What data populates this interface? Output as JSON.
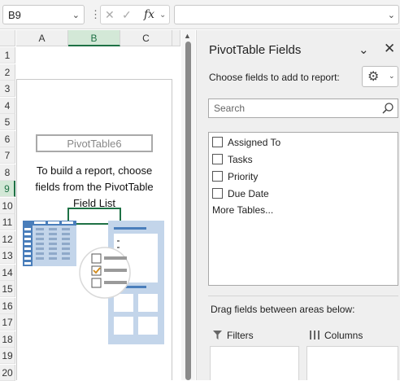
{
  "formula_bar": {
    "name_box": "B9",
    "more_dots": "⋮",
    "cancel_glyph": "✕",
    "enter_glyph": "✓",
    "fx_label": "fx",
    "formula_value": ""
  },
  "grid": {
    "columns": [
      "A",
      "B",
      "C"
    ],
    "selected_column": "B",
    "rows": [
      "1",
      "2",
      "3",
      "4",
      "5",
      "6",
      "7",
      "8",
      "9",
      "10",
      "11",
      "12",
      "13",
      "14",
      "15",
      "16",
      "17",
      "18",
      "19",
      "20"
    ],
    "selected_row": "9"
  },
  "pivot_placeholder": {
    "name": "PivotTable6",
    "instructions": "To build a report, choose fields from the PivotTable Field List"
  },
  "panel": {
    "title": "PivotTable Fields",
    "choose_label": "Choose fields to add to report:",
    "search_placeholder": "Search",
    "fields": [
      {
        "label": "Assigned To",
        "checked": false
      },
      {
        "label": "Tasks",
        "checked": false
      },
      {
        "label": "Priority",
        "checked": false
      },
      {
        "label": "Due Date",
        "checked": false
      }
    ],
    "more_tables": "More Tables...",
    "drag_label": "Drag fields between areas below:",
    "areas": [
      {
        "label": "Filters",
        "icon": "filter-icon"
      },
      {
        "label": "Columns",
        "icon": "columns-icon"
      }
    ]
  },
  "colors": {
    "accent_green": "#1e7145",
    "illustration_blue": "#4a7ebb",
    "illustration_light": "#c3d5ea"
  }
}
